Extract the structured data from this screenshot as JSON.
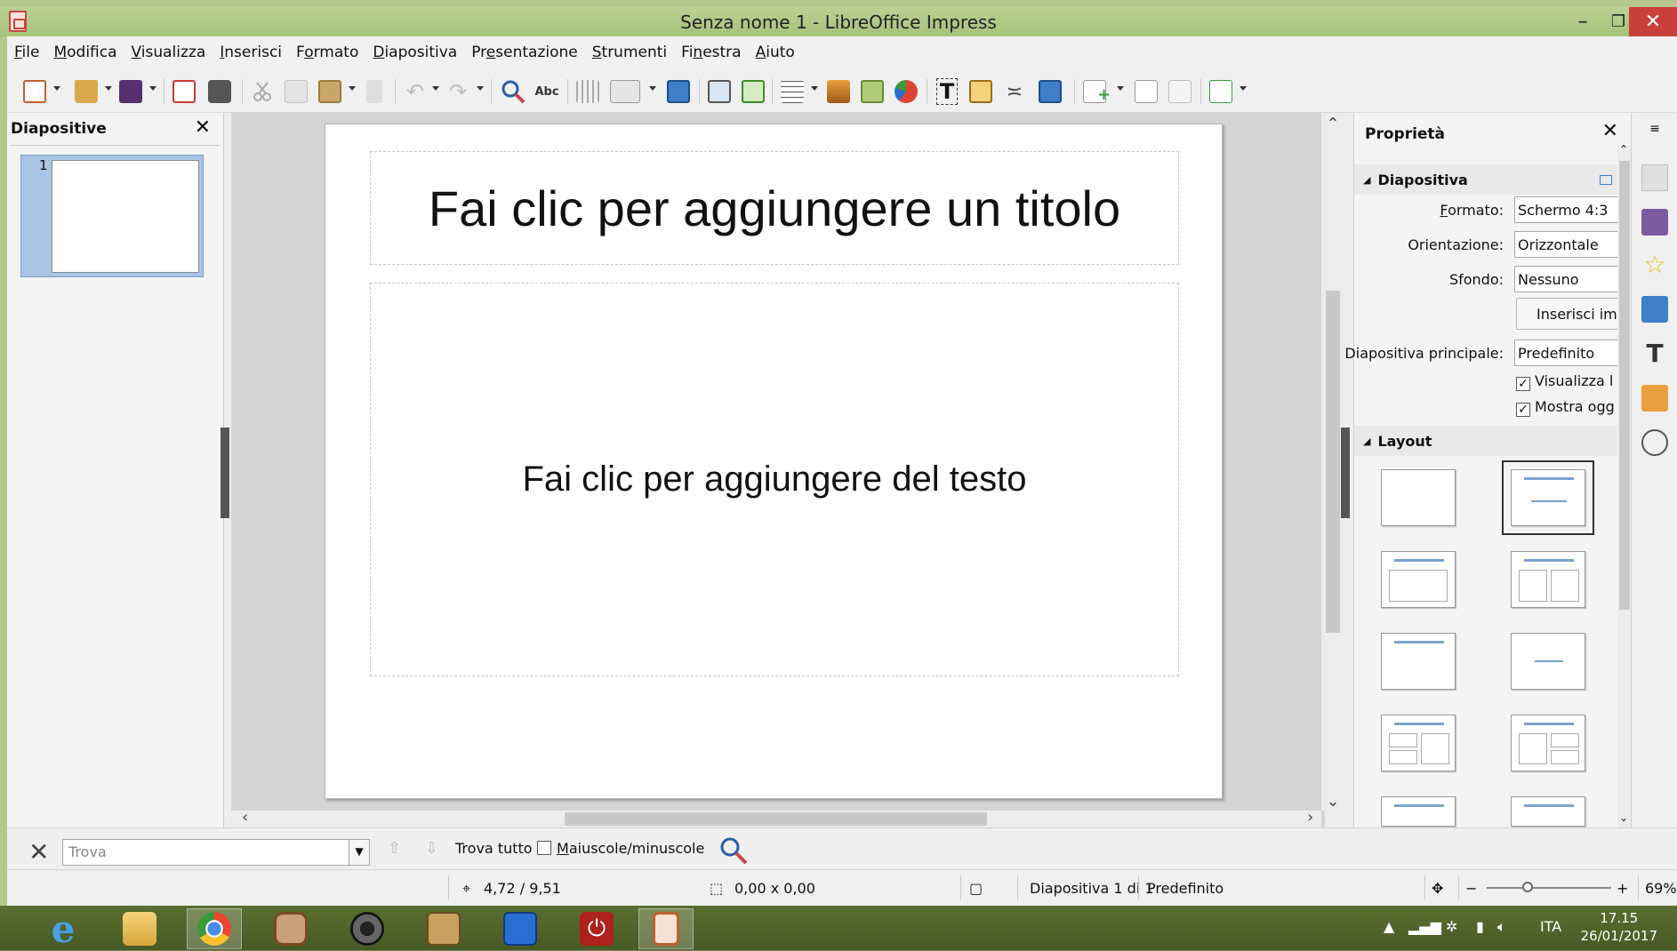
{
  "window": {
    "title": "Senza nome 1 - LibreOffice Impress",
    "min": "–",
    "restore": "❐",
    "close": "✕"
  },
  "menu": [
    {
      "u": "F",
      "rest": "ile"
    },
    {
      "u": "M",
      "rest": "odifica"
    },
    {
      "u": "V",
      "rest": "isualizza"
    },
    {
      "u": "I",
      "rest": "nserisci"
    },
    {
      "pre": "F",
      "u": "o",
      "rest": "rmato"
    },
    {
      "u": "D",
      "rest": "iapositiva"
    },
    {
      "pre": "Pr",
      "u": "e",
      "rest": "sentazione"
    },
    {
      "u": "S",
      "rest": "trumenti"
    },
    {
      "pre": "Fi",
      "u": "n",
      "rest": "estra"
    },
    {
      "u": "A",
      "rest": "iuto"
    }
  ],
  "slides_pane": {
    "title": "Diapositive",
    "close": "✕",
    "slide_number": "1"
  },
  "slide": {
    "title_placeholder": "Fai clic per aggiungere un titolo",
    "content_placeholder": "Fai clic per aggiungere del testo"
  },
  "properties": {
    "title": "Proprietà",
    "close": "✕",
    "section_slide": "Diapositiva",
    "format_label_u": "F",
    "format_label_rest": "ormato:",
    "format_value": "Schermo 4:3",
    "orientation_label": "Orientazione:",
    "orientation_value": "Orizzontale",
    "background_label": "Sfondo:",
    "background_value": "Nessuno",
    "insert_image_button": "Inserisci im",
    "master_label": "Diapositiva principale:",
    "master_value": "Predefinito",
    "show_master_bg": "Visualizza l",
    "show_master_objects": "Mostra ogg",
    "section_layout": "Layout"
  },
  "findbar": {
    "placeholder": "Trova",
    "find_all": "Trova tutto",
    "match_case_u": "M",
    "match_case_rest": "aiuscole/minuscole"
  },
  "status": {
    "position": "4,72 / 9,51",
    "size": "0,00 x 0,00",
    "slide_info": "Diapositiva 1 di 1",
    "master": "Predefinito",
    "zoom": "69%",
    "zoom_minus": "−",
    "zoom_plus": "+"
  },
  "tray": {
    "language": "ITA",
    "time": "17.15",
    "date": "26/01/2017"
  },
  "colors": {
    "titlebar": "#a6c27a",
    "taskbar": "#485a26",
    "close": "#c9403a",
    "selection": "#a9c4e4"
  }
}
